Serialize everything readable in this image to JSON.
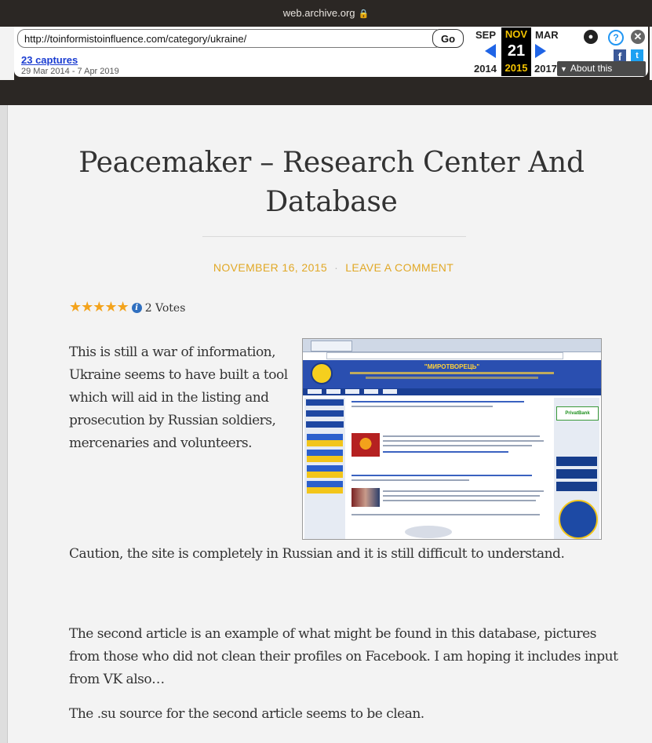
{
  "browser": {
    "domain": "web.archive.org"
  },
  "wayback": {
    "url_value": "http://toinformistoinfluence.com/category/ukraine/",
    "go_label": "Go",
    "captures_label": "23 captures",
    "date_range": "29 Mar 2014 - 7 Apr 2019",
    "months": {
      "prev": "SEP",
      "current": "NOV",
      "next": "MAR"
    },
    "day": "21",
    "years": {
      "prev": "2014",
      "current": "2015",
      "next": "2017"
    },
    "about_label": "About this capture",
    "accent_color": "#f2c200",
    "arrow_color": "#1f64e6"
  },
  "post": {
    "title": "Peacemaker – Research Center And Database",
    "date": "NOVEMBER 16, 2015",
    "separator": "·",
    "comment_link": "LEAVE A COMMENT",
    "meta_color": "#e1a826",
    "rating": {
      "stars": 5,
      "star_glyphs": "★★★★★",
      "info_glyph": "i",
      "votes": "2 Votes"
    },
    "paragraphs": [
      "This is still a war of information, Ukraine seems to have built a tool which will aid in the listing and prosecution by Russian soldiers, mercenaries and volunteers.",
      "Caution, the site is completely in Russian and it is still difficult to understand.",
      "The second article is an example of what might be found in this database, pictures from those who did not clean their profiles on Facebook.  I am hoping it includes input from VK also…",
      "The .su source for the second article seems to be clean."
    ],
    "embedded_image": {
      "site_title": "\"МИРОТВОРЕЦЬ\"",
      "bank_label": "PrivatBank"
    }
  }
}
